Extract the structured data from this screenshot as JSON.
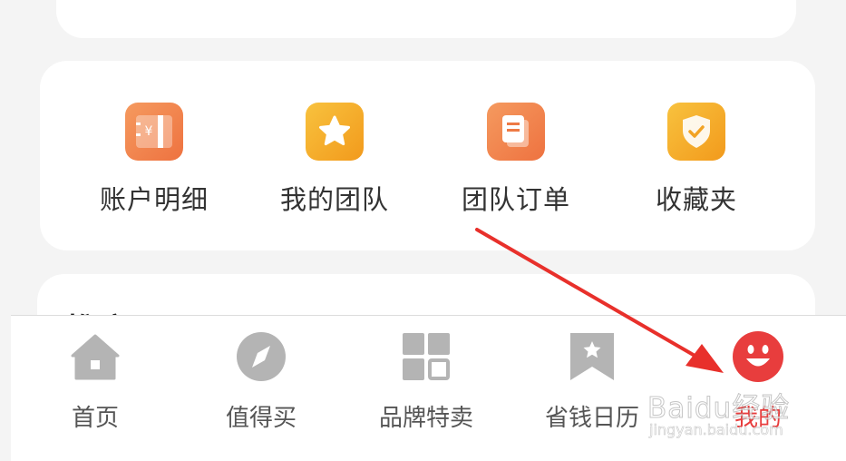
{
  "tools": {
    "items": [
      {
        "label": "账户明细",
        "icon": "ledger-icon",
        "icon_char": "¥"
      },
      {
        "label": "我的团队",
        "icon": "star-icon"
      },
      {
        "label": "团队订单",
        "icon": "document-icon"
      },
      {
        "label": "收藏夹",
        "icon": "shield-check-icon"
      }
    ]
  },
  "promo": {
    "title": "推广工具"
  },
  "tabbar": {
    "items": [
      {
        "label": "首页",
        "icon": "home-icon",
        "active": false
      },
      {
        "label": "值得买",
        "icon": "compass-icon",
        "active": false
      },
      {
        "label": "品牌特卖",
        "icon": "grid-icon",
        "active": false
      },
      {
        "label": "省钱日历",
        "icon": "bookmark-star-icon",
        "active": false
      },
      {
        "label": "我的",
        "icon": "smiley-icon",
        "active": true
      }
    ]
  },
  "watermark": {
    "text": "Baidu经验",
    "sub": "jingyan.baidu.com"
  },
  "colors": {
    "accent": "#e83d3d",
    "icon_orange": "#f0834a",
    "icon_yellow": "#f6b52b",
    "tab_gray": "#b4b4b4",
    "arrow": "#e8302b"
  }
}
